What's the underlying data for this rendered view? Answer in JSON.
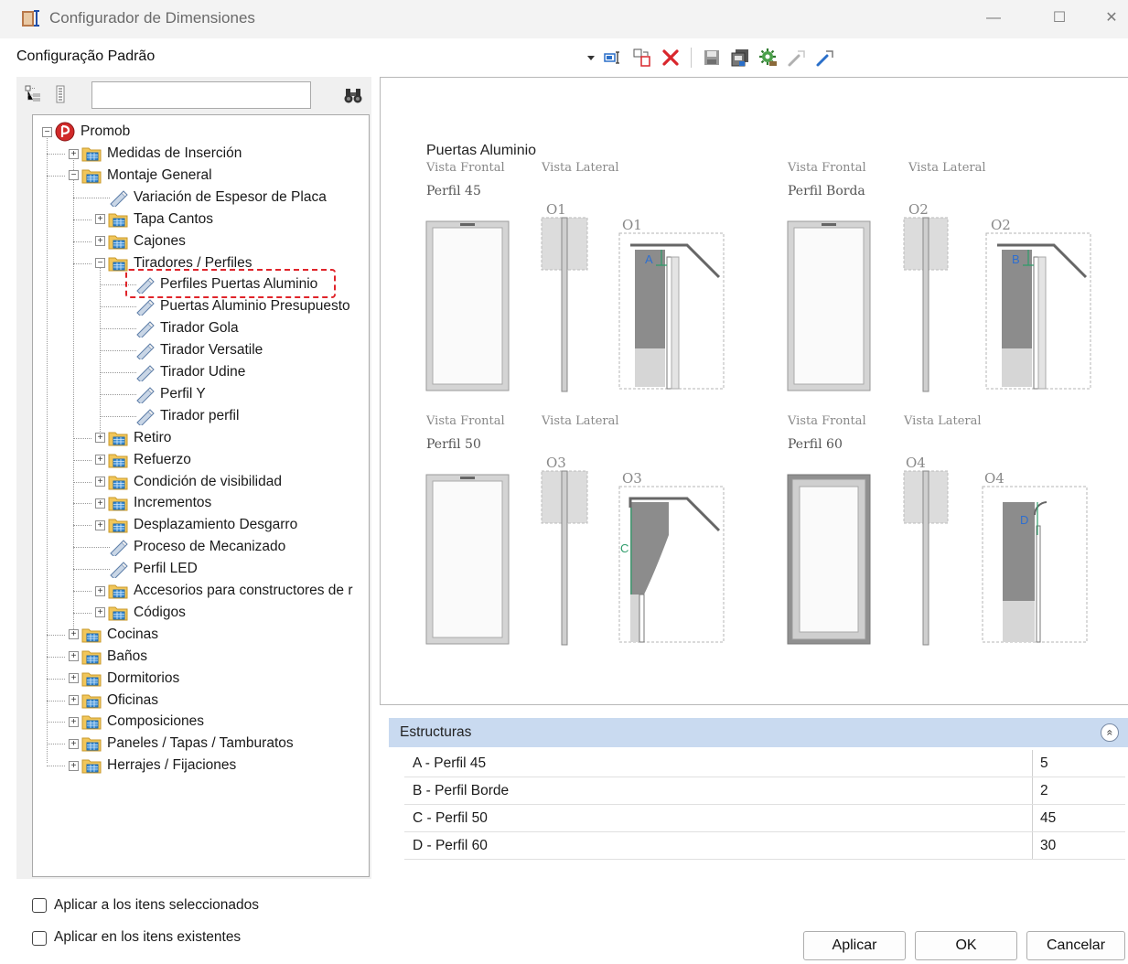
{
  "window": {
    "title": "Configurador de Dimensiones",
    "minimize_glyph": "—",
    "maximize_glyph": "☐",
    "close_glyph": "✕"
  },
  "config_name": "Configuração Padrão",
  "toolbar": {
    "icons": [
      "dropdown-arrow-icon",
      "rename-icon",
      "copy-icon",
      "delete-icon",
      "save-icon",
      "save-as-icon",
      "settings-icon",
      "export-icon",
      "import-icon"
    ]
  },
  "search": {
    "value": "",
    "find_icon": "binoculars-icon"
  },
  "tree": {
    "root": "Promob",
    "items": [
      {
        "label": "Medidas de Inserción",
        "type": "folder",
        "expander": "+"
      },
      {
        "label": "Montaje General",
        "type": "folder",
        "expander": "−"
      },
      {
        "label": "Variación de Espesor de Placa",
        "type": "leaf"
      },
      {
        "label": "Tapa Cantos",
        "type": "folder",
        "expander": "+"
      },
      {
        "label": "Cajones",
        "type": "folder",
        "expander": "+"
      },
      {
        "label": "Tiradores / Perfiles",
        "type": "folder",
        "expander": "−"
      },
      {
        "label": "Perfiles Puertas Aluminio",
        "type": "leaf",
        "selected": true
      },
      {
        "label": "Puertas Aluminio Presupuesto",
        "type": "leaf"
      },
      {
        "label": "Tirador Gola",
        "type": "leaf"
      },
      {
        "label": "Tirador Versatile",
        "type": "leaf"
      },
      {
        "label": "Tirador Udine",
        "type": "leaf"
      },
      {
        "label": "Perfil Y",
        "type": "leaf"
      },
      {
        "label": "Tirador perfil",
        "type": "leaf"
      },
      {
        "label": "Retiro",
        "type": "folder",
        "expander": "+"
      },
      {
        "label": "Refuerzo",
        "type": "folder",
        "expander": "+"
      },
      {
        "label": "Condición de visibilidad",
        "type": "folder",
        "expander": "+"
      },
      {
        "label": "Incrementos",
        "type": "folder",
        "expander": "+"
      },
      {
        "label": "Desplazamiento Desgarro",
        "type": "folder",
        "expander": "+"
      },
      {
        "label": "Proceso de Mecanizado",
        "type": "leaf"
      },
      {
        "label": "Perfil LED",
        "type": "leaf"
      },
      {
        "label": "Accesorios para constructores de r",
        "type": "folder",
        "expander": "+"
      },
      {
        "label": "Códigos",
        "type": "folder",
        "expander": "+"
      },
      {
        "label": "Cocinas",
        "type": "folder",
        "expander": "+"
      },
      {
        "label": "Baños",
        "type": "folder",
        "expander": "+"
      },
      {
        "label": "Dormitorios",
        "type": "folder",
        "expander": "+"
      },
      {
        "label": "Oficinas",
        "type": "folder",
        "expander": "+"
      },
      {
        "label": "Composiciones",
        "type": "folder",
        "expander": "+"
      },
      {
        "label": "Paneles / Tapas / Tamburatos",
        "type": "folder",
        "expander": "+"
      },
      {
        "label": "Herrajes / Fijaciones",
        "type": "folder",
        "expander": "+"
      }
    ]
  },
  "preview": {
    "title": "Puertas Aluminio",
    "vista_frontal": "Vista Frontal",
    "vista_lateral": "Vista Lateral",
    "panels": [
      {
        "perfil": "Perfil 45",
        "code": "O1",
        "letter": "A"
      },
      {
        "perfil": "Perfil Borda",
        "code": "O2",
        "letter": "B"
      },
      {
        "perfil": "Perfil 50",
        "code": "O3",
        "letter": "C"
      },
      {
        "perfil": "Perfil 60",
        "code": "O4",
        "letter": "D"
      }
    ]
  },
  "structures": {
    "title": "Estructuras",
    "collapse_glyph": "«",
    "rows": [
      {
        "label": "A - Perfil 45",
        "value": "5"
      },
      {
        "label": "B - Perfil Borde",
        "value": "2"
      },
      {
        "label": "C - Perfil 50",
        "value": "45"
      },
      {
        "label": "D - Perfil 60",
        "value": "30"
      }
    ]
  },
  "options": {
    "apply_selected": "Aplicar a los itens seleccionados",
    "apply_existing": "Aplicar en los itens existentes"
  },
  "buttons": {
    "apply": "Aplicar",
    "ok": "OK",
    "cancel": "Cancelar"
  },
  "colors": {
    "highlight": "#e0242a",
    "struct_header": "#c9daf0",
    "accent_blue": "#2a6fc9",
    "delete_red": "#d9262c"
  }
}
